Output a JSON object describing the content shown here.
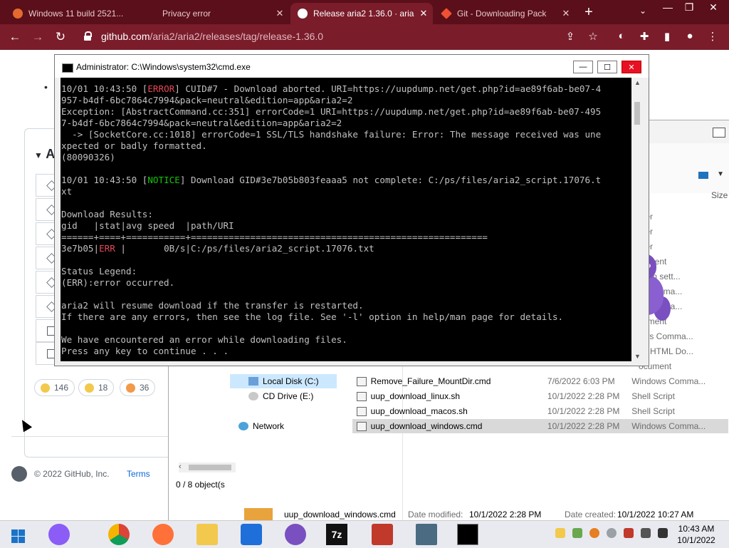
{
  "browser": {
    "tabs": [
      {
        "title": "Windows 11 build 2521...",
        "fav_color": "#e46a2f"
      },
      {
        "title": "Privacy error",
        "fav_color": "#d8d8d8"
      },
      {
        "title": "Release aria2 1.36.0 · aria",
        "fav_color": "#ffffff"
      },
      {
        "title": "Git - Downloading Pack",
        "fav_color": "#f05133"
      }
    ],
    "url_host": "github.com",
    "url_path": "/aria2/aria2/releases/tag/release-1.36.0"
  },
  "github": {
    "assets_heading": "A",
    "reactions": [
      {
        "emoji": "thumbs-up",
        "count": "146"
      },
      {
        "emoji": "laugh",
        "count": "18"
      },
      {
        "emoji": "tada",
        "count": "36"
      }
    ],
    "footer_copyright": "© 2022 GitHub, Inc.",
    "footer_terms": "Terms"
  },
  "cmd": {
    "title": "Administrator: C:\\Windows\\system32\\cmd.exe",
    "lines": [
      {
        "segments": [
          {
            "t": "10/01 10:43:50 ["
          },
          {
            "t": "ERROR",
            "c": "red"
          },
          {
            "t": "] CUID#7 - Download aborted. URI=https://uupdump.net/get.php?id=ae89f6ab-be07-4"
          }
        ]
      },
      {
        "segments": [
          {
            "t": "957-b4df-6bc7864c7994&pack=neutral&edition=app&aria2=2"
          }
        ]
      },
      {
        "segments": [
          {
            "t": "Exception: [AbstractCommand.cc:351] errorCode=1 URI=https://uupdump.net/get.php?id=ae89f6ab-be07-495"
          }
        ]
      },
      {
        "segments": [
          {
            "t": "7-b4df-6bc7864c7994&pack=neutral&edition=app&aria2=2"
          }
        ]
      },
      {
        "segments": [
          {
            "t": "  -> [SocketCore.cc:1018] errorCode=1 SSL/TLS handshake failure: Error: The message received was une"
          }
        ]
      },
      {
        "segments": [
          {
            "t": "xpected or badly formatted."
          }
        ]
      },
      {
        "segments": [
          {
            "t": "(80090326)"
          }
        ]
      },
      {
        "segments": [
          {
            "t": ""
          }
        ]
      },
      {
        "segments": [
          {
            "t": "10/01 10:43:50 ["
          },
          {
            "t": "NOTICE",
            "c": "green"
          },
          {
            "t": "] Download GID#3e7b05b803feaaa5 not complete: C:/ps/files/aria2_script.17076.t"
          }
        ]
      },
      {
        "segments": [
          {
            "t": "xt"
          }
        ]
      },
      {
        "segments": [
          {
            "t": ""
          }
        ]
      },
      {
        "segments": [
          {
            "t": "Download Results:"
          }
        ]
      },
      {
        "segments": [
          {
            "t": "gid   |stat|avg speed  |path/URI"
          }
        ]
      },
      {
        "segments": [
          {
            "t": "======+====+===========+======================================================="
          }
        ]
      },
      {
        "segments": [
          {
            "t": "3e7b05|"
          },
          {
            "t": "ERR",
            "c": "red"
          },
          {
            "t": " |       0B/s|C:/ps/files/aria2_script.17076.txt"
          }
        ]
      },
      {
        "segments": [
          {
            "t": ""
          }
        ]
      },
      {
        "segments": [
          {
            "t": "Status Legend:"
          }
        ]
      },
      {
        "segments": [
          {
            "t": "(ERR):error occurred."
          }
        ]
      },
      {
        "segments": [
          {
            "t": ""
          }
        ]
      },
      {
        "segments": [
          {
            "t": "aria2 will resume download if the transfer is restarted."
          }
        ]
      },
      {
        "segments": [
          {
            "t": "If there are any errors, then see the log file. See '-l' option in help/man page for details."
          }
        ]
      },
      {
        "segments": [
          {
            "t": ""
          }
        ]
      },
      {
        "segments": [
          {
            "t": "We have encountered an error while downloading files."
          }
        ]
      },
      {
        "segments": [
          {
            "t": "Press any key to continue . . ."
          }
        ]
      }
    ]
  },
  "explorer": {
    "size_header": "Size",
    "type_column_fragments": [
      "lder",
      "lder",
      "lder",
      "cument",
      "ation sett...",
      "s Comma...",
      "s Comma...",
      "cument",
      "ows Comma...",
      "oc HTML Do...",
      "ocument"
    ],
    "tree": [
      {
        "label": "Local Disk (C:)",
        "selected": true
      },
      {
        "label": "CD Drive (E:)",
        "selected": false
      },
      {
        "label": "Network",
        "selected": false
      }
    ],
    "files": [
      {
        "name": "Remove_Failure_MountDir.cmd",
        "date": "7/6/2022 6:03 PM",
        "type": "Windows Comma...",
        "selected": false
      },
      {
        "name": "uup_download_linux.sh",
        "date": "10/1/2022 2:28 PM",
        "type": "Shell Script",
        "selected": false
      },
      {
        "name": "uup_download_macos.sh",
        "date": "10/1/2022 2:28 PM",
        "type": "Shell Script",
        "selected": false
      },
      {
        "name": "uup_download_windows.cmd",
        "date": "10/1/2022 2:28 PM",
        "type": "Windows Comma...",
        "selected": true
      }
    ],
    "object_count": "0 / 8 object(s",
    "details": {
      "filename": "uup_download_windows.cmd",
      "modified_label": "Date modified:",
      "modified_value": "10/1/2022 2:28 PM",
      "created_label": "Date created:",
      "created_value": "10/1/2022 10:27 AM"
    }
  },
  "taskbar": {
    "time": "10:43 AM",
    "date": "10/1/2022"
  },
  "colors": {
    "tabstrip": "#5a0f1a",
    "toolbar": "#7a1c2a",
    "console_bg": "#000000",
    "error_red": "#e74856",
    "notice_green": "#16c60c"
  }
}
